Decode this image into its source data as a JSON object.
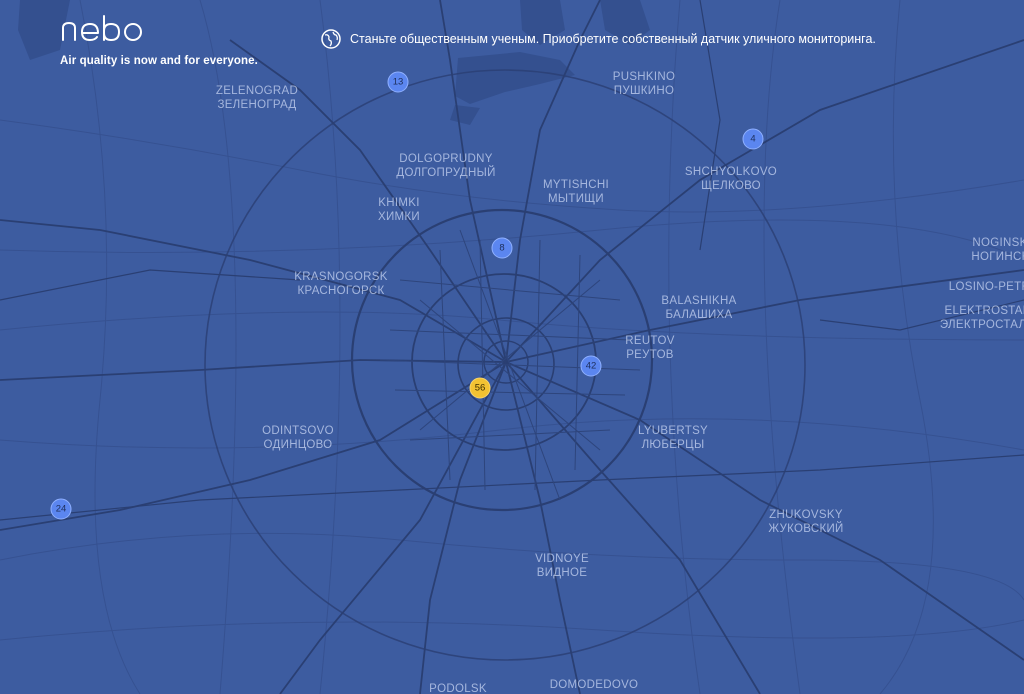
{
  "header": {
    "logo_text": "nebo",
    "tagline": "Air quality is now and for everyone.",
    "promo_text": "Станьте общественным ученым. Приобретите собственный датчик уличного мониторинга.",
    "promo_icon": "globe-icon"
  },
  "colors": {
    "map_background": "#3d5ca0",
    "road": "#2a3f73",
    "marker_default": "#5b86f0",
    "marker_highlight": "#f2c232"
  },
  "cities": [
    {
      "id": "zelenograd",
      "latin": "ZELENOGRAD",
      "cyrillic": "ЗЕЛЕНОГРАД"
    },
    {
      "id": "pushkino",
      "latin": "PUSHKINO",
      "cyrillic": "ПУШКИНО"
    },
    {
      "id": "dolgoprudny",
      "latin": "DOLGOPRUDNY",
      "cyrillic": "ДОЛГОПРУДНЫЙ"
    },
    {
      "id": "mytishchi",
      "latin": "MYTISHCHI",
      "cyrillic": "МЫТИЩИ"
    },
    {
      "id": "shchyolkovo",
      "latin": "SHCHYOLKOVO",
      "cyrillic": "ЩЕЛКОВО"
    },
    {
      "id": "khimki",
      "latin": "KHIMKI",
      "cyrillic": "ХИМКИ"
    },
    {
      "id": "noginsk",
      "latin": "NOGINSK",
      "cyrillic": "НОГИНСК"
    },
    {
      "id": "krasnogorsk",
      "latin": "KRASNOGORSK",
      "cyrillic": "КРАСНОГОРСК"
    },
    {
      "id": "balashikha",
      "latin": "BALASHIKHA",
      "cyrillic": "БАЛАШИХА"
    },
    {
      "id": "losino",
      "latin": "LOSINO-PETROVSKY",
      "cyrillic": ""
    },
    {
      "id": "elektrostal",
      "latin": "ELEKTROSTAL",
      "cyrillic": "ЭЛЕКТРОСТАЛЬ"
    },
    {
      "id": "reutov",
      "latin": "REUTOV",
      "cyrillic": "РЕУТОВ"
    },
    {
      "id": "odintsovo",
      "latin": "ODINTSOVO",
      "cyrillic": "ОДИНЦОВО"
    },
    {
      "id": "lyubertsy",
      "latin": "LYUBERTSY",
      "cyrillic": "ЛЮБЕРЦЫ"
    },
    {
      "id": "zhukovsky",
      "latin": "ZHUKOVSKY",
      "cyrillic": "ЖУКОВСКИЙ"
    },
    {
      "id": "vidnoye",
      "latin": "VIDNOYE",
      "cyrillic": "ВИДНОЕ"
    },
    {
      "id": "podolsk",
      "latin": "PODOLSK",
      "cyrillic": ""
    },
    {
      "id": "domodedovo",
      "latin": "DOMODEDOVO",
      "cyrillic": ""
    }
  ],
  "markers": [
    {
      "id": "m13",
      "count": "13",
      "color": "#5b86f0"
    },
    {
      "id": "m4",
      "count": "4",
      "color": "#5b86f0"
    },
    {
      "id": "m8",
      "count": "8",
      "color": "#5b86f0"
    },
    {
      "id": "m42",
      "count": "42",
      "color": "#5b86f0"
    },
    {
      "id": "m56",
      "count": "56",
      "color": "#f2c232"
    },
    {
      "id": "m24",
      "count": "24",
      "color": "#5b86f0"
    }
  ]
}
